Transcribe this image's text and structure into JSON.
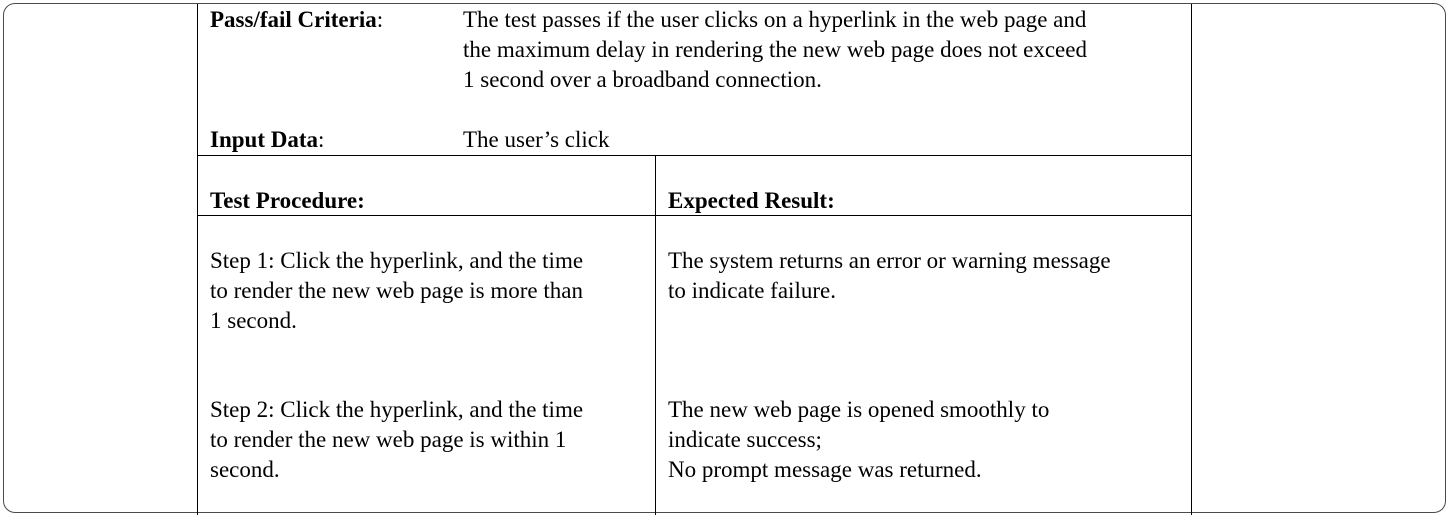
{
  "criteria": {
    "pass_fail_label": "Pass/fail Criteria",
    "pass_fail_colon": ":",
    "pass_fail_text": "The test passes if the user clicks on a hyperlink in the web page and\nthe maximum delay in rendering the new web page does not exceed\n1 second over a broadband connection.",
    "input_label": "Input Data",
    "input_colon": ":",
    "input_text": "The user’s click"
  },
  "table": {
    "procedure_header": "Test Procedure:",
    "result_header": "Expected Result:",
    "rows": [
      {
        "procedure": "Step 1: Click the hyperlink, and the time\nto render the new web page is more than\n1 second.",
        "result": "The system returns an error or warning message\nto indicate failure."
      },
      {
        "procedure": "Step 2: Click the hyperlink, and the time\nto render the new web page is within 1\nsecond.",
        "result": "The new web page is opened smoothly to\nindicate success;\nNo prompt message was returned."
      }
    ]
  }
}
